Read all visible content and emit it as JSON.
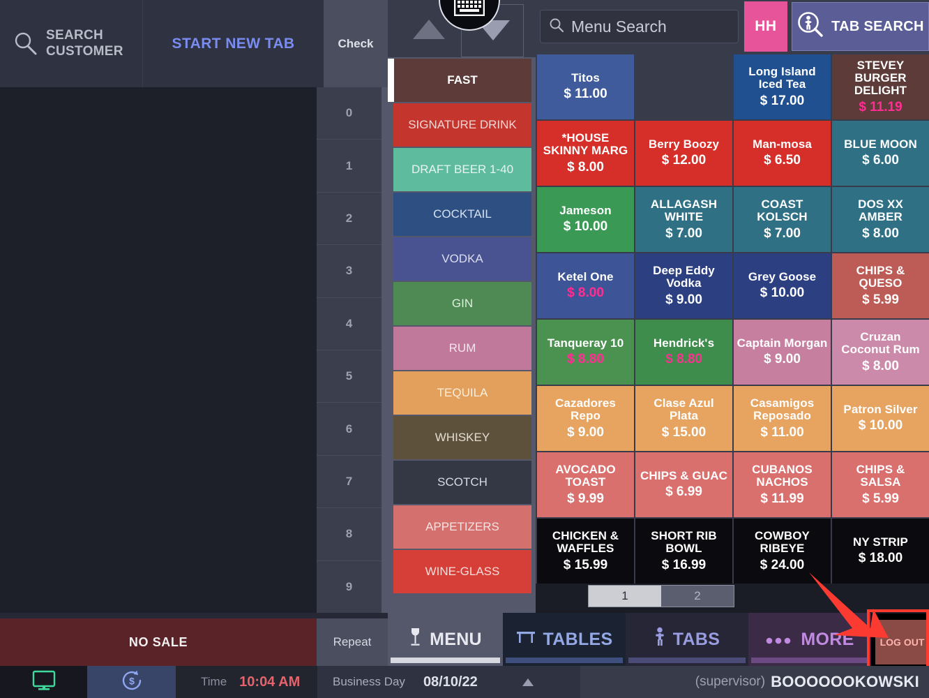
{
  "topbar": {
    "search_customer_line1": "SEARCH",
    "search_customer_line2": "CUSTOMER",
    "start_new_tab": "START NEW TAB",
    "check": "Check"
  },
  "search": {
    "menu_search_placeholder": "Menu Search",
    "hh_label": "HH",
    "tab_search_label": "TAB SEARCH"
  },
  "number_rail": [
    "0",
    "1",
    "2",
    "3",
    "4",
    "5",
    "6",
    "7",
    "8",
    "9"
  ],
  "actions": {
    "no_sale": "NO SALE",
    "repeat": "Repeat"
  },
  "categories": [
    {
      "label": "FAST",
      "color": "#5c3b38",
      "text": "#ffffff",
      "active": true
    },
    {
      "label": "SIGNATURE DRINK",
      "color": "#c4352e",
      "text": "#f3d6d4",
      "active": false
    },
    {
      "label": "DRAFT BEER 1-40",
      "color": "#5fbb9e",
      "text": "#e6f5ef",
      "active": false
    },
    {
      "label": "COCKTAIL",
      "color": "#2d4f82",
      "text": "#d6e2f2",
      "active": false
    },
    {
      "label": "VODKA",
      "color": "#4a5391",
      "text": "#dadef0",
      "active": false
    },
    {
      "label": "GIN",
      "color": "#4f8a54",
      "text": "#dcefdd",
      "active": false
    },
    {
      "label": "RUM",
      "color": "#c1799b",
      "text": "#f6e4ed",
      "active": false
    },
    {
      "label": "TEQUILA",
      "color": "#e3a05c",
      "text": "#fbeedd",
      "active": false
    },
    {
      "label": "WHISKEY",
      "color": "#5e513b",
      "text": "#e4ded2",
      "active": false
    },
    {
      "label": "SCOTCH",
      "color": "#343845",
      "text": "#d8dae4",
      "active": false
    },
    {
      "label": "APPETIZERS",
      "color": "#d4716f",
      "text": "#f8e2e1",
      "active": false
    },
    {
      "label": "WINE-GLASS",
      "color": "#d63f38",
      "text": "#f8dcda",
      "active": false
    }
  ],
  "products": [
    {
      "name": "Titos",
      "price": "$ 11.00",
      "color": "#3f5b9b",
      "highlight": false
    },
    {
      "name": "",
      "price": "",
      "color": "#383b4a",
      "empty": true
    },
    {
      "name": "Long Island Iced Tea",
      "price": "$ 17.00",
      "color": "#20508f",
      "highlight": false
    },
    {
      "name": "STEVEY BURGER DELIGHT",
      "price": "$ 11.19",
      "color": "#5c3b38",
      "highlight": true
    },
    {
      "name": "*HOUSE SKINNY MARG",
      "price": "$ 8.00",
      "color": "#d62f29",
      "highlight": false
    },
    {
      "name": "Berry Boozy",
      "price": "$ 12.00",
      "color": "#d62f29",
      "highlight": false
    },
    {
      "name": "Man-mosa",
      "price": "$ 6.50",
      "color": "#d62f29",
      "highlight": false
    },
    {
      "name": "BLUE MOON",
      "price": "$ 6.00",
      "color": "#2f7085",
      "highlight": false
    },
    {
      "name": "Jameson",
      "price": "$ 10.00",
      "color": "#3a9a55",
      "highlight": false
    },
    {
      "name": "ALLAGASH WHITE",
      "price": "$ 7.00",
      "color": "#2f7085",
      "highlight": false
    },
    {
      "name": "COAST KOLSCH",
      "price": "$ 7.00",
      "color": "#2f7085",
      "highlight": false
    },
    {
      "name": "DOS XX AMBER",
      "price": "$ 8.00",
      "color": "#2f7085",
      "highlight": false
    },
    {
      "name": "Ketel One",
      "price": "$ 8.00",
      "color": "#3d5596",
      "highlight": true
    },
    {
      "name": "Deep Eddy Vodka",
      "price": "$ 9.00",
      "color": "#2c3f81",
      "highlight": false
    },
    {
      "name": "Grey Goose",
      "price": "$ 10.00",
      "color": "#2c3f81",
      "highlight": false
    },
    {
      "name": "CHIPS & QUESO",
      "price": "$ 5.99",
      "color": "#bd5c56",
      "highlight": false
    },
    {
      "name": "Tanqueray 10",
      "price": "$ 8.80",
      "color": "#4b9250",
      "highlight": true
    },
    {
      "name": "Hendrick's",
      "price": "$ 8.80",
      "color": "#3f8d4c",
      "highlight": true
    },
    {
      "name": "Captain Morgan",
      "price": "$ 9.00",
      "color": "#c77fa0",
      "highlight": false
    },
    {
      "name": "Cruzan Coconut Rum",
      "price": "$ 8.00",
      "color": "#cc8aaa",
      "highlight": false
    },
    {
      "name": "Cazadores Repo",
      "price": "$ 9.00",
      "color": "#e7a461",
      "highlight": false
    },
    {
      "name": "Clase Azul Plata",
      "price": "$ 15.00",
      "color": "#e7a461",
      "highlight": false
    },
    {
      "name": "Casamigos Reposado",
      "price": "$ 11.00",
      "color": "#e7a461",
      "highlight": false
    },
    {
      "name": "Patron Silver",
      "price": "$ 10.00",
      "color": "#e7a461",
      "highlight": false
    },
    {
      "name": "AVOCADO TOAST",
      "price": "$ 9.99",
      "color": "#d9706e",
      "highlight": false
    },
    {
      "name": "CHIPS & GUAC",
      "price": "$ 6.99",
      "color": "#d9706e",
      "highlight": false
    },
    {
      "name": "CUBANOS NACHOS",
      "price": "$ 11.99",
      "color": "#d9706e",
      "highlight": false
    },
    {
      "name": "CHIPS & SALSA",
      "price": "$ 5.99",
      "color": "#d9706e",
      "highlight": false
    },
    {
      "name": "CHICKEN & WAFFLES",
      "price": "$ 15.99",
      "color": "#0b0b0f",
      "highlight": false
    },
    {
      "name": "SHORT RIB BOWL",
      "price": "$ 16.99",
      "color": "#0b0b0f",
      "highlight": false
    },
    {
      "name": "COWBOY RIBEYE",
      "price": "$ 24.00",
      "color": "#0b0b0f",
      "highlight": false
    },
    {
      "name": "NY STRIP",
      "price": "$ 18.00",
      "color": "#0b0b0f",
      "highlight": false
    }
  ],
  "pagination": {
    "pages": [
      "1",
      "2"
    ],
    "current": "1"
  },
  "bottom_nav": [
    {
      "label": "MENU",
      "icon": "wine-glass-icon",
      "active": true
    },
    {
      "label": "TABLES",
      "icon": "table-icon",
      "active": false
    },
    {
      "label": "TABS",
      "icon": "person-icon",
      "active": false
    },
    {
      "label": "MORE",
      "icon": "ellipsis-icon",
      "active": false
    }
  ],
  "logout": {
    "label": "LOG OUT"
  },
  "status_bar": {
    "time_label": "Time",
    "time_value": "10:04 AM",
    "business_day_label": "Business Day",
    "business_day_value": "08/10/22",
    "user_role": "(supervisor)",
    "user_name": "BOOOOOOKOWSKI"
  },
  "colors": {
    "accent_pink": "#ff2e92",
    "hh_pink": "#e8549a",
    "tab_search_purple": "#5b5d96",
    "highlight_red": "#ff3b30"
  }
}
